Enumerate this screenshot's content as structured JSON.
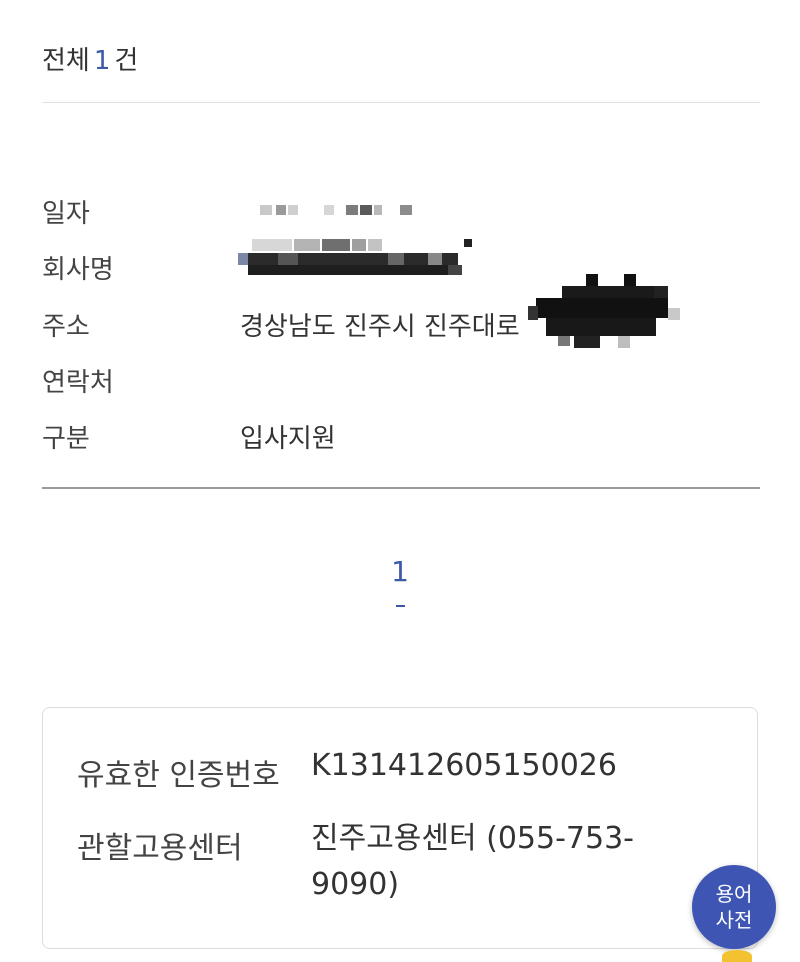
{
  "header": {
    "prefix": "전체",
    "count": "1",
    "suffix": "건"
  },
  "record": {
    "date_label": "일자",
    "company_label": "회사명",
    "address_label": "주소",
    "address_value": "경상남도 진주시 진주대로",
    "contact_label": "연락처",
    "category_label": "구분",
    "category_value": "입사지원"
  },
  "pagination": {
    "current_page": "1"
  },
  "info": {
    "cert_label": "유효한 인증번호",
    "cert_value": "K131412605150026",
    "center_label": "관할고용센터",
    "center_value": "진주고용센터 (055-753-9090)"
  },
  "fab": {
    "line1": "용어",
    "line2": "사전"
  },
  "colors": {
    "accent": "#3d5aa8",
    "fab_bg": "#3f55b3"
  }
}
